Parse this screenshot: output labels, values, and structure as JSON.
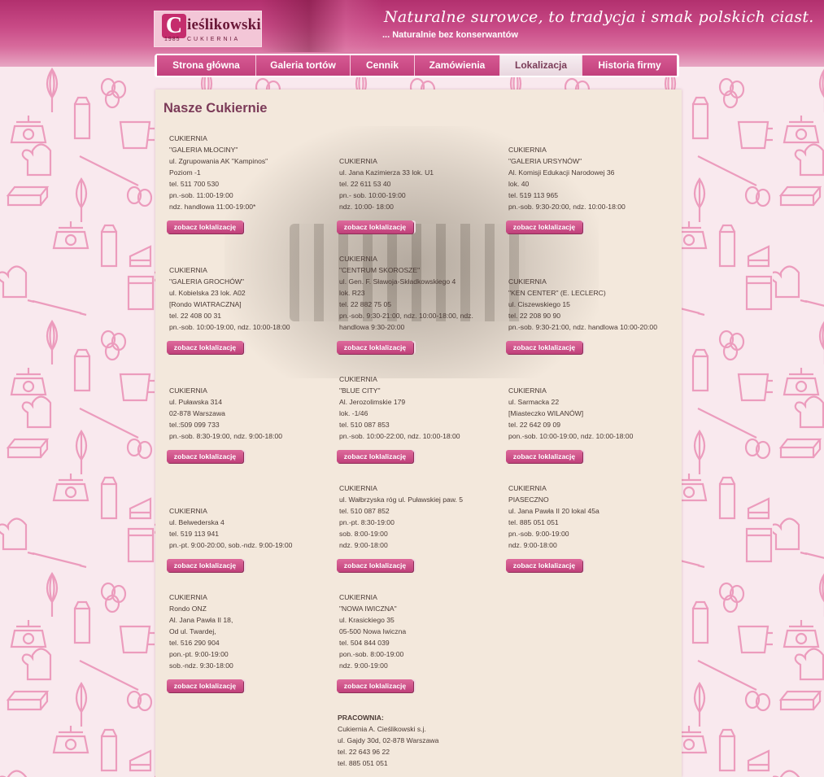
{
  "header": {
    "logo_letter": "C",
    "logo_name": "ieślikowski",
    "logo_year": "1985",
    "logo_sub": "CUKIERNIA",
    "slogan": "Naturalne surowce, to tradycja i smak polskich ciast.",
    "slogan_sub": "... Naturalnie bez konserwantów"
  },
  "nav": {
    "items": [
      {
        "label": "Strona główna"
      },
      {
        "label": "Galeria tortów"
      },
      {
        "label": "Cennik"
      },
      {
        "label": "Zamówienia"
      },
      {
        "label": "Lokalizacja"
      },
      {
        "label": "Historia firmy"
      }
    ],
    "active": "Lokalizacja"
  },
  "page_title": "Nasze Cukiernie",
  "button_label": "zobacz loklalizację",
  "shops": [
    {
      "lines": [
        "CUKIERNIA",
        "\"GALERIA MŁOCINY\"",
        "ul. Zgrupowania AK \"Kampinos\"",
        "Poziom -1",
        "tel. 511 700 530",
        "pn.-sob. 11:00-19:00",
        "ndz. handlowa 11:00-19:00*"
      ]
    },
    {
      "lines": [
        "CUKIERNIA",
        "ul. Jana Kazimierza 33 lok. U1",
        "tel. 22 611 53 40",
        "pn.- sob. 10:00-19:00",
        "ndz. 10:00- 18:00"
      ]
    },
    {
      "lines": [
        "CUKIERNIA",
        "\"GALERIA URSYNÓW\"",
        "Al. Komisji Edukacji Narodowej 36",
        "lok. 40",
        "tel. 519 113 965",
        "pn.-sob. 9:30-20:00, ndz. 10:00-18:00"
      ]
    },
    {
      "lines": [
        "CUKIERNIA",
        "\"GALERIA GROCHÓW\"",
        "ul. Kobielska 23 lok. A02",
        "[Rondo WIATRACZNA]",
        "tel. 22 408 00 31",
        "pn.-sob. 10:00-19:00, ndz. 10:00-18:00"
      ]
    },
    {
      "lines": [
        "CUKIERNIA",
        "\"CENTRUM SKOROSZE\"",
        "ul. Gen. F. Sławoja-Składkowskiego 4",
        "lok. R23",
        "tel. 22 882 75 05",
        "pn.-sob. 9:30-21:00, ndz. 10:00-18:00, ndz.",
        "handlowa 9:30-20:00"
      ]
    },
    {
      "lines": [
        "CUKIERNIA",
        "\"KEN CENTER\" (E. LECLERC)",
        "ul. Ciszewskiego 15",
        "tel. 22 208 90 90",
        "pn.-sob. 9:30-21:00, ndz. handlowa 10:00-20:00"
      ]
    },
    {
      "lines": [
        "CUKIERNIA",
        "ul. Puławska 314",
        "02-878 Warszawa",
        "tel.:509 099 733",
        "pn.-sob. 8:30-19:00, ndz. 9:00-18:00"
      ]
    },
    {
      "lines": [
        "CUKIERNIA",
        "\"BLUE CITY\"",
        "Al. Jerozolimskie 179",
        "lok. -1/46",
        "tel. 510 087 853",
        "pn.-sob. 10:00-22:00, ndz. 10:00-18:00"
      ]
    },
    {
      "lines": [
        "CUKIERNIA",
        "ul. Sarmacka 22",
        "[Miasteczko WILANÓW]",
        "tel. 22 642 09 09",
        "pon.-sob. 10:00-19:00, ndz. 10:00-18:00"
      ]
    },
    {
      "lines": [
        "CUKIERNIA",
        "ul. Belwederska 4",
        "tel. 519 113 941",
        "pn.-pt. 9:00-20:00, sob.-ndz. 9:00-19:00"
      ]
    },
    {
      "lines": [
        "CUKIERNIA",
        "ul. Wałbrzyska róg ul. Puławskiej paw. 5",
        "tel. 510 087 852",
        "pn.-pt. 8:30-19:00",
        "sob. 8:00-19:00",
        "ndz. 9:00-18:00"
      ]
    },
    {
      "lines": [
        "CUKIERNIA",
        "PIASECZNO",
        "ul. Jana Pawła II 20 lokal 45a",
        "tel. 885 051 051",
        "pn.-sob. 9:00-19:00",
        "ndz. 9:00-18:00"
      ]
    },
    {
      "lines": [
        "CUKIERNIA",
        "Rondo ONZ",
        "Al. Jana Pawła II 18,",
        "Od ul. Twardej,",
        "tel. 516 290 904",
        "pon.-pt. 9:00-19:00",
        "sob.-ndz. 9:30-18:00"
      ]
    },
    {
      "lines": [
        "CUKIERNIA",
        "\"NOWA IWICZNA\"",
        "ul. Krasickiego 35",
        "05-500 Nowa Iwiczna",
        "tel. 504 844 039",
        "pon.-sob. 8:00-19:00",
        "ndz. 9:00-19:00"
      ]
    }
  ],
  "workshop": {
    "lines": [
      "PRACOWNIA:",
      "Cukiernia A. Cieślikowski s.j.",
      "ul. Gajdy 30d, 02-878 Warszawa",
      "tel. 22 643 96 22",
      "tel. 885 051 051"
    ]
  }
}
